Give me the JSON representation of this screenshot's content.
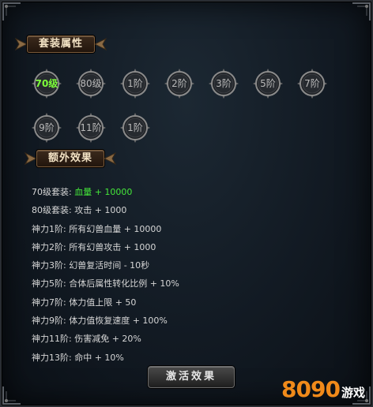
{
  "sections": {
    "set_attributes_title": "套装属性",
    "extra_effects_title": "额外效果"
  },
  "badges": [
    {
      "label": "70级",
      "active": true
    },
    {
      "label": "80级",
      "active": false
    },
    {
      "label": "1阶",
      "active": false
    },
    {
      "label": "2阶",
      "active": false
    },
    {
      "label": "3阶",
      "active": false
    },
    {
      "label": "5阶",
      "active": false
    },
    {
      "label": "7阶",
      "active": false
    },
    {
      "label": "9阶",
      "active": false
    },
    {
      "label": "11阶",
      "active": false
    },
    {
      "label": "1阶",
      "active": false
    }
  ],
  "effects": [
    {
      "label": "70级套装:",
      "value": "血量 + 10000",
      "active": true
    },
    {
      "label": "80级套装:",
      "value": "攻击 + 1000",
      "active": false
    },
    {
      "label": "神力1阶:",
      "value": "所有幻兽血量 + 10000",
      "active": false
    },
    {
      "label": "神力2阶:",
      "value": "所有幻兽攻击 + 1000",
      "active": false
    },
    {
      "label": "神力3阶:",
      "value": "幻兽复活时间 - 10秒",
      "active": false
    },
    {
      "label": "神力5阶:",
      "value": "合体后属性转化比例 + 10%",
      "active": false
    },
    {
      "label": "神力7阶:",
      "value": "体力值上限 + 50",
      "active": false
    },
    {
      "label": "神力9阶:",
      "value": "体力值恢复速度 + 100%",
      "active": false
    },
    {
      "label": "神力11阶:",
      "value": "伤害减免 + 20%",
      "active": false
    },
    {
      "label": "神力13阶:",
      "value": "命中 + 10%",
      "active": false
    }
  ],
  "activate_button_label": "激活效果",
  "watermark": {
    "number": "8090",
    "text": "游戏"
  },
  "colors": {
    "active_green": "#45e83a",
    "badge_active": "#7dff3a",
    "accent_gold": "#7a5a3a"
  }
}
